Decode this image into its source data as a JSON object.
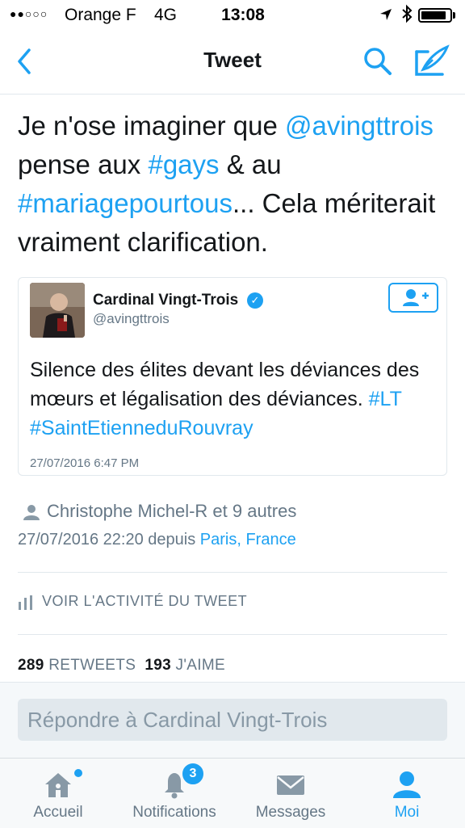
{
  "status_bar": {
    "signal": "●●○○○",
    "carrier": "Orange F",
    "network": "4G",
    "time": "13:08"
  },
  "nav": {
    "title": "Tweet"
  },
  "tweet": {
    "text_part1": "Je n'ose imaginer que ",
    "mention": "@avingttrois",
    "text_part2": " pense aux ",
    "hashtag1": "#gays",
    "text_part3": " & au ",
    "hashtag2": "#mariagepourtous",
    "text_part4": "... Cela mériterait vraiment clarification."
  },
  "quoted_tweet": {
    "name": "Cardinal Vingt-Trois",
    "handle": "@avingttrois",
    "text": "Silence des élites devant les déviances des mœurs et légalisation des déviances. ",
    "hashtag1": "#LT",
    "hashtag2": "#SaintEtienneduRouvray",
    "date": "27/07/2016 6:47 PM"
  },
  "meta": {
    "users": "Christophe Michel-R et 9 autres",
    "datetime": "27/07/2016 22:20 depuis ",
    "location": "Paris, France"
  },
  "activity_label": "VOIR L'ACTIVITÉ DU TWEET",
  "stats": {
    "retweets_count": "289",
    "retweets_label": "RETWEETS",
    "likes_count": "193",
    "likes_label": "J'AIME"
  },
  "reply": {
    "placeholder": "Répondre à Cardinal Vingt-Trois"
  },
  "tabs": [
    {
      "label": "Accueil",
      "icon": "home-icon"
    },
    {
      "label": "Notifications",
      "icon": "bell-icon",
      "badge": "3"
    },
    {
      "label": "Messages",
      "icon": "envelope-icon"
    },
    {
      "label": "Moi",
      "icon": "person-icon"
    }
  ],
  "colors": {
    "accent": "#1da1f2",
    "text": "#14171a",
    "secondary": "#657786"
  }
}
